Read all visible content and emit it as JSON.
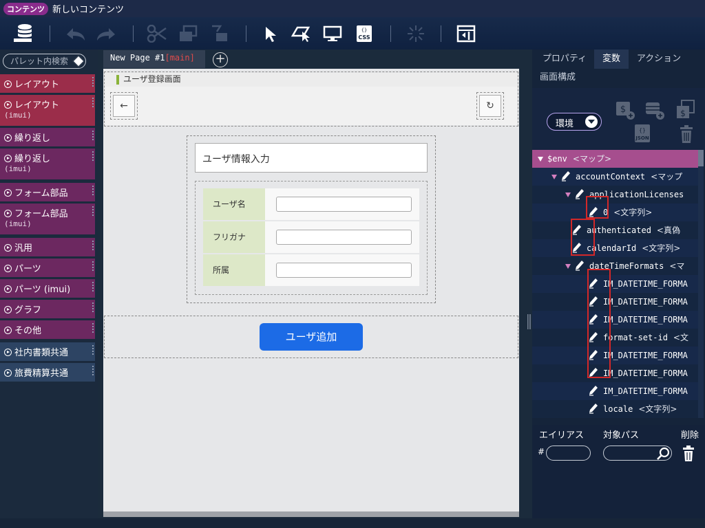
{
  "title": {
    "badge": "コンテンツ",
    "text": "新しいコンテンツ"
  },
  "palette": {
    "search_placeholder": "パレット内検索",
    "items": [
      {
        "label": "レイアウト",
        "sub": "",
        "color": "#9b2d4a"
      },
      {
        "label": "レイアウト",
        "sub": "(imui)",
        "color": "#9b2d4a"
      },
      {
        "label": "繰り返し",
        "sub": "",
        "color": "#6c2860"
      },
      {
        "label": "繰り返し",
        "sub": "(imui)",
        "color": "#6c2860"
      },
      {
        "label": "フォーム部品",
        "sub": "",
        "color": "#6c2860"
      },
      {
        "label": "フォーム部品",
        "sub": "(imui)",
        "color": "#6c2860"
      },
      {
        "label": "汎用",
        "sub": "",
        "color": "#6c2860"
      },
      {
        "label": "パーツ",
        "sub": "",
        "color": "#6c2860"
      },
      {
        "label": "パーツ (imui)",
        "sub": "",
        "color": "#6c2860"
      },
      {
        "label": "グラフ",
        "sub": "",
        "color": "#6c2860"
      },
      {
        "label": "その他",
        "sub": "",
        "color": "#6c2860"
      },
      {
        "label": "社内書類共通",
        "sub": "",
        "color": "#2d4463"
      },
      {
        "label": "旅費精算共通",
        "sub": "",
        "color": "#2d4463"
      }
    ]
  },
  "canvas": {
    "tab_name": "New Page #1",
    "tab_suffix": "[main]",
    "header_title": "ユーザ登録画面",
    "form_title": "ユーザ情報入力",
    "fields": [
      "ユーザ名",
      "フリガナ",
      "所属"
    ],
    "submit_label": "ユーザ追加"
  },
  "right_panel": {
    "tabs": [
      "プロパティ",
      "変数",
      "アクション"
    ],
    "active_tab": "変数",
    "screen_tab": "画面構成",
    "env_select": "環境",
    "tree": [
      {
        "name": "$env",
        "type": "<マップ>",
        "indent": 0,
        "arrow": true,
        "pen": false
      },
      {
        "name": "accountContext",
        "type": "<マップ",
        "indent": 1,
        "arrow": true,
        "pen": true
      },
      {
        "name": "applicationLicenses",
        "type": "",
        "indent": 2,
        "arrow": true,
        "pen": true
      },
      {
        "name": "0",
        "type": "<文字列>",
        "indent": 3,
        "arrow": false,
        "pen": true
      },
      {
        "name": "authenticated",
        "type": "<真偽",
        "indent": 2,
        "arrow": false,
        "pen": true
      },
      {
        "name": "calendarId",
        "type": "<文字列>",
        "indent": 2,
        "arrow": false,
        "pen": true
      },
      {
        "name": "dateTimeFormats",
        "type": "<マ",
        "indent": 2,
        "arrow": true,
        "pen": true
      },
      {
        "name": "IM_DATETIME_FORMA",
        "type": "",
        "indent": 3,
        "arrow": false,
        "pen": true
      },
      {
        "name": "IM_DATETIME_FORMA",
        "type": "",
        "indent": 3,
        "arrow": false,
        "pen": true
      },
      {
        "name": "IM_DATETIME_FORMA",
        "type": "",
        "indent": 3,
        "arrow": false,
        "pen": true
      },
      {
        "name": "format-set-id",
        "type": "<文",
        "indent": 3,
        "arrow": false,
        "pen": true
      },
      {
        "name": "IM_DATETIME_FORMA",
        "type": "",
        "indent": 3,
        "arrow": false,
        "pen": true
      },
      {
        "name": "IM_DATETIME_FORMA",
        "type": "",
        "indent": 3,
        "arrow": false,
        "pen": true
      },
      {
        "name": "IM_DATETIME_FORMA",
        "type": "",
        "indent": 3,
        "arrow": false,
        "pen": true
      },
      {
        "name": "locale",
        "type": "<文字列>",
        "indent": 3,
        "arrow": false,
        "pen": true
      }
    ],
    "alias": {
      "alias_header": "エイリアス",
      "path_header": "対象パス",
      "delete_header": "削除",
      "hash": "#"
    }
  }
}
